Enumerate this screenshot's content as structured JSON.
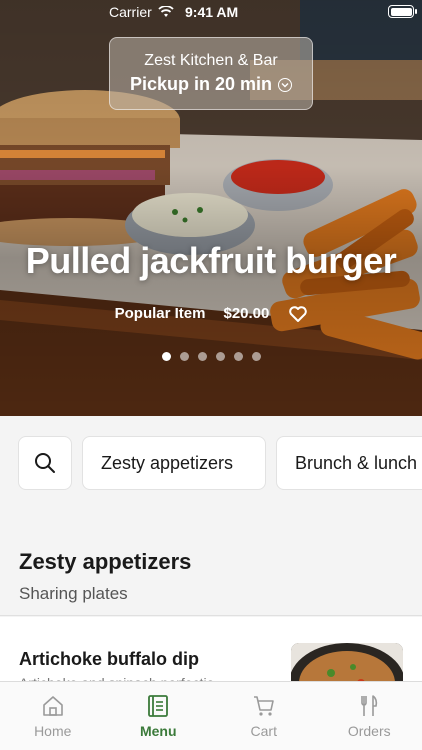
{
  "status_bar": {
    "carrier": "Carrier",
    "time": "9:41 AM"
  },
  "location": {
    "name": "Zest Kitchen & Bar",
    "pickup": "Pickup in 20 min"
  },
  "hero": {
    "title": "Pulled jackfruit burger",
    "tag": "Popular Item",
    "price": "$20.00",
    "slides": 6,
    "active_slide": 1
  },
  "categories": [
    "Zesty appetizers",
    "Brunch & lunch"
  ],
  "section": {
    "title": "Zesty appetizers",
    "subtitle": "Sharing plates"
  },
  "items": [
    {
      "name": "Artichoke buffalo dip",
      "description": "Artichoke and spinach perfectio"
    }
  ],
  "tabs": [
    {
      "label": "Home",
      "icon": "home-icon"
    },
    {
      "label": "Menu",
      "icon": "menu-book-icon"
    },
    {
      "label": "Cart",
      "icon": "cart-icon"
    },
    {
      "label": "Orders",
      "icon": "fork-knife-icon"
    }
  ],
  "colors": {
    "accent": "#3b7a3a",
    "inactive": "#9a9a9a"
  }
}
